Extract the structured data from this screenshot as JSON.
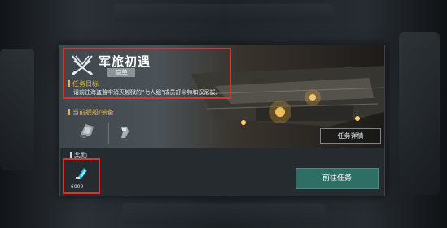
{
  "mission": {
    "title": "军旅初遇",
    "difficulty": "简单",
    "objective_heading": "任务目标",
    "objective_text": "请前往海盗监牢消灭越狱的\"七人组\"成员舒米特和汉尼拔。",
    "icon": "crossed-swords-emblem-icon"
  },
  "equipment": {
    "heading": "当前舰船/装备",
    "items": [
      "ship-icon",
      "equipment-icon"
    ]
  },
  "details_button": "任务详情",
  "rewards": {
    "heading": "奖励",
    "items": [
      {
        "icon": "crystal-item-icon",
        "count": "6000"
      }
    ]
  },
  "go_button": "前往任务",
  "colors": {
    "accent_gold": "#e0b34a",
    "highlight_red": "#d9352e",
    "go_button": "#2f6e64"
  }
}
